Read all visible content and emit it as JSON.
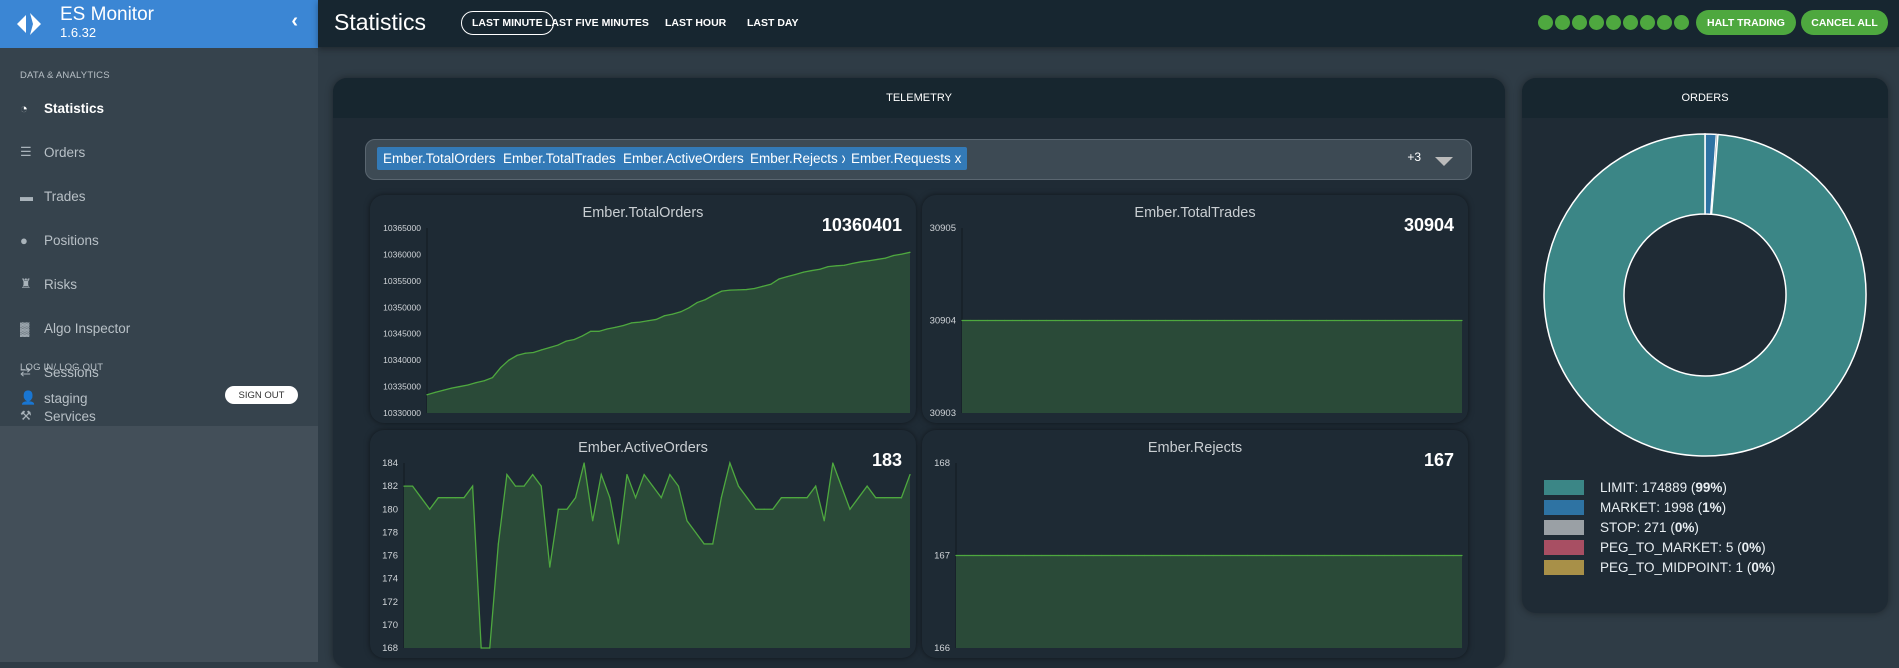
{
  "app": {
    "name": "ES Monitor",
    "version": "1.6.32"
  },
  "sidebar": {
    "section1": "DATA & ANALYTICS",
    "items": [
      {
        "label": "Statistics",
        "icon": "dashboard-icon",
        "active": true
      },
      {
        "label": "Orders",
        "icon": "list-icon"
      },
      {
        "label": "Trades",
        "icon": "card-icon"
      },
      {
        "label": "Positions",
        "icon": "piggy-bank-icon"
      },
      {
        "label": "Risks",
        "icon": "tower-icon"
      },
      {
        "label": "Algo Inspector",
        "icon": "bar-chart-icon"
      },
      {
        "label": "Sessions",
        "icon": "transfer-icon"
      },
      {
        "label": "Services",
        "icon": "wrench-icon"
      }
    ],
    "section2": "LOG IN/ LOG OUT",
    "user": "staging",
    "signout": "SIGN OUT"
  },
  "header": {
    "title": "Statistics",
    "ranges": [
      "LAST MINUTE",
      "LAST FIVE MINUTES",
      "LAST HOUR",
      "LAST DAY"
    ],
    "selected_range": "LAST MINUTE",
    "status_dots": 9,
    "halt": "HALT TRADING",
    "cancel": "CANCEL ALL"
  },
  "colors": {
    "accent": "#3b86d4",
    "green": "#4ea83f",
    "tag": "#337ab7",
    "fill": "#2a4a38"
  },
  "telemetry": {
    "title": "TELEMETRY",
    "tags": [
      "Ember.TotalOrders",
      "Ember.TotalTrades",
      "Ember.ActiveOrders",
      "Ember.Rejects",
      "Ember.Requests"
    ],
    "tag_remove": "x",
    "more": "+3"
  },
  "orders": {
    "title": "ORDERS"
  },
  "chart_data": [
    {
      "type": "area",
      "title": "Ember.TotalOrders",
      "current": "10360401",
      "ylim": [
        10330000,
        10365000
      ],
      "yticks": [
        10365000,
        10360000,
        10355000,
        10350000,
        10345000,
        10340000,
        10335000,
        10330000
      ],
      "values": [
        10333450,
        10333900,
        10334300,
        10334700,
        10335000,
        10335300,
        10335750,
        10336100,
        10336700,
        10338600,
        10340000,
        10340900,
        10341300,
        10341450,
        10341950,
        10342400,
        10342850,
        10343600,
        10343900,
        10344600,
        10345450,
        10345450,
        10345900,
        10346200,
        10346550,
        10347050,
        10347200,
        10347450,
        10347700,
        10348400,
        10348700,
        10349150,
        10349900,
        10350900,
        10351450,
        10352300,
        10353050,
        10353250,
        10353300,
        10353350,
        10353550,
        10353950,
        10354350,
        10355350,
        10355800,
        10356200,
        10356650,
        10356950,
        10357200,
        10357700,
        10357850,
        10357950,
        10358300,
        10358600,
        10358800,
        10359050,
        10359300,
        10359800,
        10360050,
        10360401
      ]
    },
    {
      "type": "area",
      "title": "Ember.TotalTrades",
      "current": "30904",
      "ylim": [
        30903,
        30905
      ],
      "yticks": [
        30905,
        30904,
        30903
      ],
      "values": [
        30904,
        30904,
        30904,
        30904,
        30904,
        30904,
        30904,
        30904,
        30904,
        30904,
        30904,
        30904,
        30904,
        30904,
        30904,
        30904,
        30904,
        30904,
        30904,
        30904,
        30904,
        30904,
        30904,
        30904,
        30904,
        30904,
        30904,
        30904,
        30904,
        30904,
        30904,
        30904,
        30904,
        30904,
        30904,
        30904,
        30904,
        30904,
        30904,
        30904,
        30904,
        30904,
        30904,
        30904,
        30904,
        30904,
        30904,
        30904,
        30904,
        30904,
        30904,
        30904,
        30904,
        30904,
        30904,
        30904,
        30904,
        30904,
        30904,
        30904
      ]
    },
    {
      "type": "area",
      "title": "Ember.ActiveOrders",
      "current": "183",
      "ylim": [
        168,
        184
      ],
      "yticks": [
        184,
        182,
        180,
        178,
        176,
        174,
        172,
        170,
        168
      ],
      "values": [
        182,
        182,
        181,
        180,
        181,
        181,
        181,
        181,
        182,
        168,
        168,
        177,
        183,
        182,
        182,
        183,
        182,
        175,
        180,
        180,
        181,
        184,
        179,
        183,
        181,
        177,
        183,
        181,
        183,
        182,
        181,
        183,
        182,
        179,
        178,
        177,
        177,
        181,
        184,
        182,
        181,
        180,
        180,
        180,
        181,
        181,
        181,
        181,
        182,
        179,
        184,
        182,
        180,
        181,
        182,
        181,
        181,
        181,
        181,
        183
      ]
    },
    {
      "type": "area",
      "title": "Ember.Rejects",
      "current": "167",
      "ylim": [
        166,
        168
      ],
      "yticks": [
        168,
        167,
        166
      ],
      "values": [
        167,
        167,
        167,
        167,
        167,
        167,
        167,
        167,
        167,
        167,
        167,
        167,
        167,
        167,
        167,
        167,
        167,
        167,
        167,
        167,
        167,
        167,
        167,
        167,
        167,
        167,
        167,
        167,
        167,
        167,
        167,
        167,
        167,
        167,
        167,
        167,
        167,
        167,
        167,
        167,
        167,
        167,
        167,
        167,
        167,
        167,
        167,
        167,
        167,
        167,
        167,
        167,
        167,
        167,
        167,
        167,
        167,
        167,
        167,
        167
      ]
    },
    {
      "type": "pie",
      "donut": true,
      "title": "ORDERS",
      "slices": [
        {
          "name": "LIMIT",
          "value": 174889,
          "pct": "99%",
          "color": "#3b8686"
        },
        {
          "name": "MARKET",
          "value": 1998,
          "pct": "1%",
          "color": "#2e73a3"
        },
        {
          "name": "STOP",
          "value": 271,
          "pct": "0%",
          "color": "#9aa0a5"
        },
        {
          "name": "PEG_TO_MARKET",
          "value": 5,
          "pct": "0%",
          "color": "#a84f63"
        },
        {
          "name": "PEG_TO_MIDPOINT",
          "value": 1,
          "pct": "0%",
          "color": "#a89048"
        }
      ]
    }
  ]
}
